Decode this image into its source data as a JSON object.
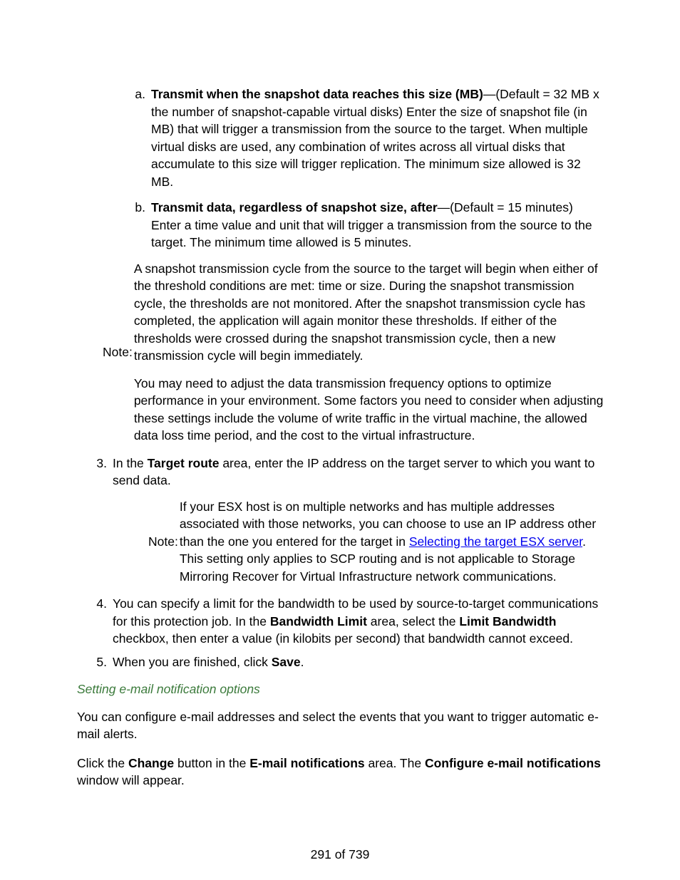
{
  "list": {
    "a": {
      "label_marker": "a.",
      "bold": "Transmit when the snapshot data reaches this size (MB)",
      "rest": "—(Default = 32 MB x the number of snapshot-capable virtual disks) Enter the size of snapshot file (in MB) that will trigger a transmission from the source to the target. When multiple virtual disks are used, any combination of writes across all virtual disks that accumulate to this size will trigger replication. The minimum size allowed is 32 MB."
    },
    "b": {
      "label_marker": "b.",
      "bold": "Transmit data, regardless of snapshot size, after",
      "rest": "—(Default = 15 minutes) Enter a time value and unit that will trigger a transmission from the source to the target. The minimum time allowed is 5 minutes."
    },
    "note1": {
      "label": "Note:",
      "p1": "A snapshot transmission cycle from the source to the target will begin when either of the threshold conditions are met: time or size. During the snapshot transmission cycle, the thresholds are not monitored. After the snapshot transmission cycle has completed, the application will again monitor these thresholds. If either of the thresholds were crossed during the snapshot transmission cycle, then a new transmission cycle will begin immediately.",
      "p2": "You may need to adjust the data transmission frequency options to optimize performance in your environment. Some factors you need to consider when adjusting these settings include the volume of write traffic in the virtual machine, the allowed data loss time period, and the cost to the virtual infrastructure."
    },
    "item3": {
      "marker": "3.",
      "pre": "In the ",
      "bold": "Target route",
      "post": " area, enter the IP address on the target server to which you want to send data."
    },
    "note2": {
      "label": "Note:",
      "pre": "If your ESX host is on multiple networks and has multiple addresses associated with those networks, you can choose to use an IP address other than the one you entered for the target in ",
      "link": "Selecting the target ESX server",
      "post": ". This setting only applies to SCP routing and is not applicable to Storage Mirroring Recover for Virtual Infrastructure network communications."
    },
    "item4": {
      "marker": "4.",
      "t1": "You can specify a limit for the bandwidth to be used by source-to-target communications for this protection job. In the ",
      "b1": "Bandwidth Limit",
      "t2": " area, select the ",
      "b2": "Limit Bandwidth",
      "t3": " checkbox, then enter a value (in kilobits per second) that bandwidth cannot exceed."
    },
    "item5": {
      "marker": "5.",
      "t1": "When you are finished, click ",
      "b1": "Save",
      "t2": "."
    }
  },
  "section_heading": "Setting e-mail notification options",
  "para1": "You can configure e-mail addresses and select the events that you want to trigger automatic e-mail alerts.",
  "para2": {
    "t1": "Click the ",
    "b1": "Change",
    "t2": " button in the ",
    "b2": "E-mail notifications",
    "t3": " area. The ",
    "b3": "Configure e-mail notifications",
    "t4": " window will appear."
  },
  "footer": "291 of 739"
}
